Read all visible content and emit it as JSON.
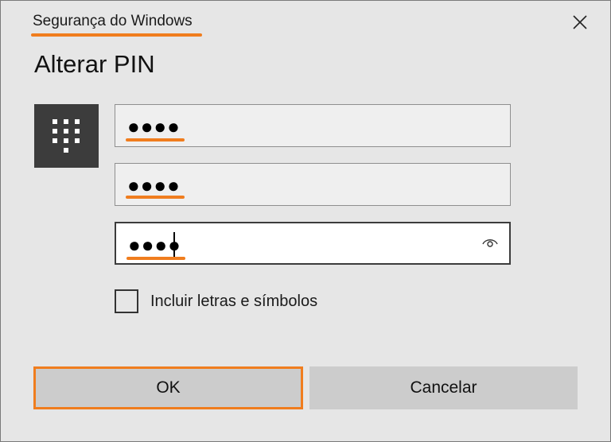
{
  "window": {
    "title": "Segurança do Windows",
    "close_icon": "close-icon"
  },
  "heading": "Alterar PIN",
  "pin_icon": "keypad-icon",
  "fields": [
    {
      "value": "●●●●",
      "masked": true,
      "focused": false
    },
    {
      "value": "●●●●",
      "masked": true,
      "focused": false
    },
    {
      "value": "●●●●",
      "masked": true,
      "focused": true
    }
  ],
  "reveal_icon": "eye-icon",
  "checkbox": {
    "label": "Incluir letras e símbolos",
    "checked": false
  },
  "buttons": {
    "ok": "OK",
    "cancel": "Cancelar"
  },
  "colors": {
    "accent_highlight": "#f07d1e",
    "background": "#e6e6e6",
    "button": "#cccccc",
    "pin_tile": "#3c3c3c"
  }
}
